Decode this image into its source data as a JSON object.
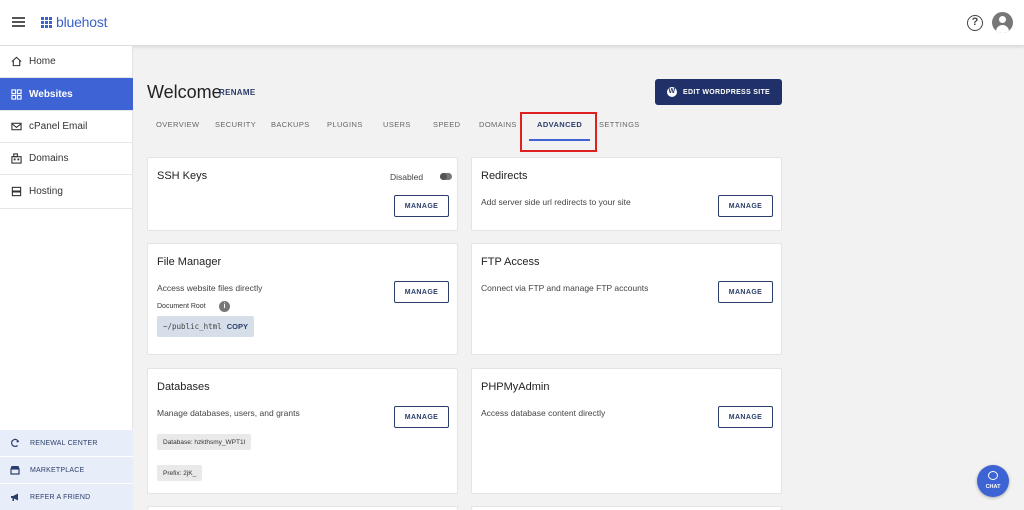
{
  "header": {
    "brand": "bluehost",
    "help_symbol": "?",
    "icons": {
      "menu": "hamburger-icon",
      "help": "help-icon",
      "account": "user-icon"
    }
  },
  "sidebar": {
    "items": [
      {
        "label": "Home",
        "icon": "home-icon",
        "active": false
      },
      {
        "label": "Websites",
        "icon": "websites-icon",
        "active": true
      },
      {
        "label": "cPanel Email",
        "icon": "email-icon",
        "active": false
      },
      {
        "label": "Domains",
        "icon": "domains-icon",
        "active": false
      },
      {
        "label": "Hosting",
        "icon": "hosting-icon",
        "active": false
      }
    ],
    "footer": [
      {
        "label": "RENEWAL CENTER",
        "icon": "renewal-icon"
      },
      {
        "label": "MARKETPLACE",
        "icon": "marketplace-icon"
      },
      {
        "label": "REFER A FRIEND",
        "icon": "megaphone-icon"
      }
    ]
  },
  "main": {
    "title": "Welcome",
    "rename_label": "RENAME",
    "edit_button": "EDIT WORDPRESS SITE",
    "wp_letter": "W",
    "tabs": [
      {
        "label": "OVERVIEW",
        "active": false
      },
      {
        "label": "SECURITY",
        "active": false
      },
      {
        "label": "BACKUPS",
        "active": false
      },
      {
        "label": "PLUGINS",
        "active": false
      },
      {
        "label": "USERS",
        "active": false
      },
      {
        "label": "SPEED",
        "active": false
      },
      {
        "label": "DOMAINS",
        "active": false
      },
      {
        "label": "ADVANCED",
        "active": true
      },
      {
        "label": "SETTINGS",
        "active": false
      }
    ]
  },
  "cards": {
    "ssh": {
      "title": "SSH Keys",
      "status": "Disabled",
      "button": "MANAGE"
    },
    "redirects": {
      "title": "Redirects",
      "desc": "Add server side url redirects to your site",
      "button": "MANAGE"
    },
    "file_manager": {
      "title": "File Manager",
      "desc": "Access website files directly",
      "doc_root_label": "Document Root",
      "info_symbol": "i",
      "path": "~/public_html",
      "copy_label": "COPY",
      "button": "MANAGE"
    },
    "ftp": {
      "title": "FTP Access",
      "desc": "Connect via FTP and manage FTP accounts",
      "button": "MANAGE"
    },
    "databases": {
      "title": "Databases",
      "desc": "Manage databases, users, and grants",
      "database_chip": "Database: hzkthsmy_WPT1I",
      "prefix_chip": "Prefix: 2jK_",
      "button": "MANAGE"
    },
    "phpmyadmin": {
      "title": "PHPMyAdmin",
      "desc": "Access database content directly",
      "button": "MANAGE"
    }
  },
  "chat": {
    "label": "CHAT"
  },
  "colors": {
    "accent": "#3d63d4",
    "navy": "#1f3168",
    "highlight": "#e0201e"
  }
}
